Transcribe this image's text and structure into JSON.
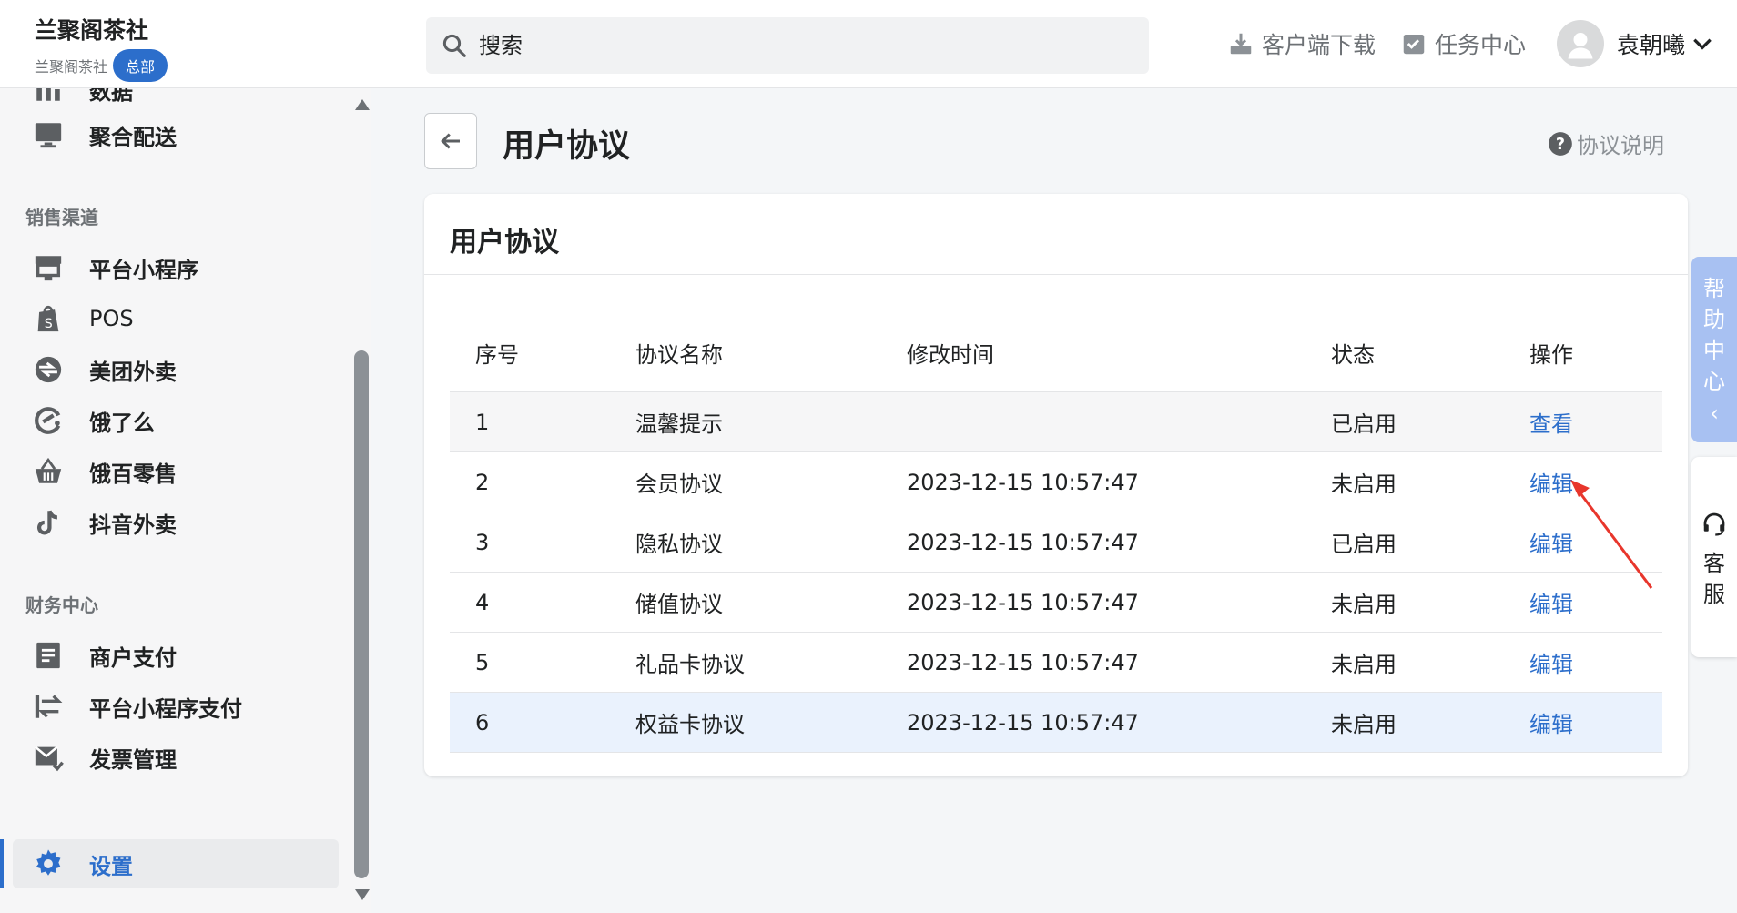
{
  "brand": {
    "name": "兰聚阁茶社",
    "sub": "兰聚阁茶社",
    "badge": "总部"
  },
  "search": {
    "placeholder": "搜索"
  },
  "topbar": {
    "download": "客户端下载",
    "tasks": "任务中心",
    "user": "袁朝曦"
  },
  "sidebar": {
    "partial_top": "数据",
    "delivery": "聚合配送",
    "section_sales": "销售渠道",
    "sales": [
      "平台小程序",
      "POS",
      "美团外卖",
      "饿了么",
      "饿百零售",
      "抖音外卖"
    ],
    "section_finance": "财务中心",
    "finance": [
      "商户支付",
      "平台小程序支付",
      "发票管理"
    ],
    "settings": "设置"
  },
  "page": {
    "title": "用户协议",
    "help": "协议说明"
  },
  "card": {
    "title": "用户协议"
  },
  "table": {
    "headers": [
      "序号",
      "协议名称",
      "修改时间",
      "状态",
      "操作"
    ],
    "rows": [
      {
        "no": "1",
        "name": "温馨提示",
        "time": "",
        "status": "已启用",
        "action": "查看"
      },
      {
        "no": "2",
        "name": "会员协议",
        "time": "2023-12-15 10:57:47",
        "status": "未启用",
        "action": "编辑"
      },
      {
        "no": "3",
        "name": "隐私协议",
        "time": "2023-12-15 10:57:47",
        "status": "已启用",
        "action": "编辑"
      },
      {
        "no": "4",
        "name": "储值协议",
        "time": "2023-12-15 10:57:47",
        "status": "未启用",
        "action": "编辑"
      },
      {
        "no": "5",
        "name": "礼品卡协议",
        "time": "2023-12-15 10:57:47",
        "status": "未启用",
        "action": "编辑"
      },
      {
        "no": "6",
        "name": "权益卡协议",
        "time": "2023-12-15 10:57:47",
        "status": "未启用",
        "action": "编辑"
      }
    ]
  },
  "float": {
    "help_center": [
      "帮",
      "助",
      "中",
      "心"
    ],
    "help_center_chevron": "‹",
    "service": [
      "客",
      "服"
    ]
  },
  "colors": {
    "accent": "#2c6ecb",
    "annotation": "#e8362c"
  }
}
